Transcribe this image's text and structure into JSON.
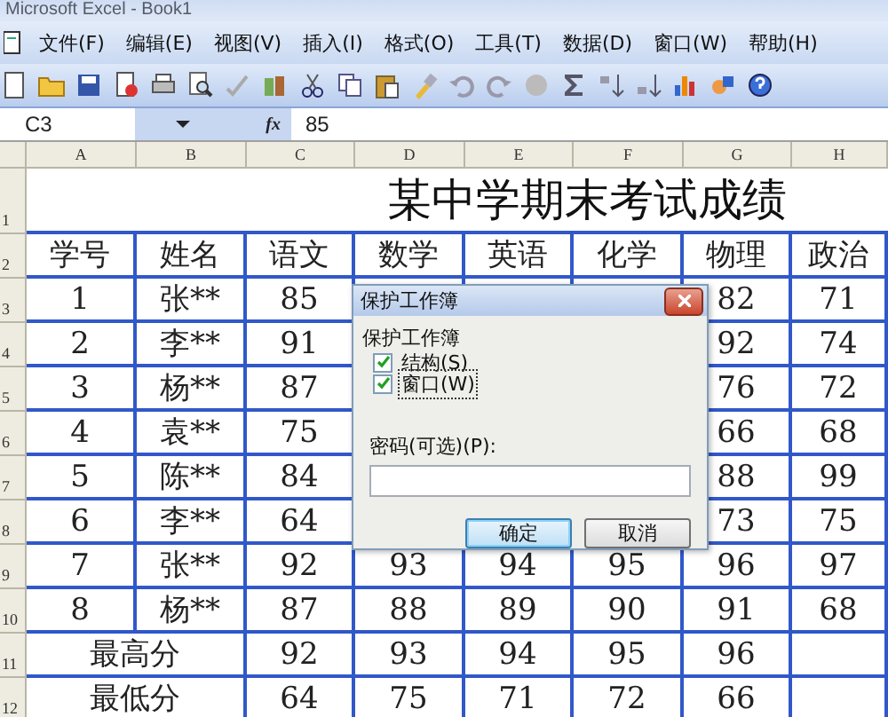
{
  "window": {
    "title": "Microsoft Excel - Book1"
  },
  "menu": [
    "文件(F)",
    "编辑(E)",
    "视图(V)",
    "插入(I)",
    "格式(O)",
    "工具(T)",
    "数据(D)",
    "窗口(W)",
    "帮助(H)"
  ],
  "formula_bar": {
    "name_box": "C3",
    "fx": "fx",
    "value": "85"
  },
  "sheet": {
    "columns": [
      "A",
      "B",
      "C",
      "D",
      "E",
      "F",
      "G",
      "H"
    ],
    "rows": [
      {
        "kind": "title",
        "number": "1",
        "text": "某中学期末考试成绩"
      },
      {
        "kind": "cells",
        "number": "2",
        "cells": [
          "学号",
          "姓名",
          "语文",
          "数学",
          "英语",
          "化学",
          "物理",
          "政治"
        ]
      },
      {
        "kind": "cells",
        "number": "3",
        "cells": [
          "1",
          "张**",
          "85"
        ],
        "right_cells": [
          "82",
          "71"
        ]
      },
      {
        "kind": "cells",
        "number": "4",
        "cells": [
          "2",
          "李**",
          "91"
        ],
        "right_cells": [
          "92",
          "74"
        ]
      },
      {
        "kind": "cells",
        "number": "5",
        "cells": [
          "3",
          "杨**",
          "87"
        ],
        "right_cells": [
          "76",
          "72"
        ]
      },
      {
        "kind": "cells",
        "number": "6",
        "cells": [
          "4",
          "袁**",
          "75"
        ],
        "right_cells": [
          "66",
          "68"
        ]
      },
      {
        "kind": "cells",
        "number": "7",
        "cells": [
          "5",
          "陈**",
          "84"
        ],
        "right_cells": [
          "88",
          "99"
        ]
      },
      {
        "kind": "cells",
        "number": "8",
        "cells": [
          "6",
          "李**",
          "64"
        ],
        "right_cells": [
          "73",
          "75"
        ]
      },
      {
        "kind": "cells",
        "number": "9",
        "cells": [
          "7",
          "张**",
          "92",
          "93",
          "94",
          "95",
          "96",
          "97"
        ]
      },
      {
        "kind": "cells",
        "number": "10",
        "cells": [
          "8",
          "杨**",
          "87",
          "88",
          "89",
          "90",
          "91",
          "68"
        ]
      },
      {
        "kind": "summary",
        "number": "11",
        "label": "最高分",
        "cells": [
          "92",
          "93",
          "94",
          "95",
          "96"
        ]
      },
      {
        "kind": "summary",
        "number": "12",
        "label": "最低分",
        "cells": [
          "64",
          "75",
          "71",
          "72",
          "66"
        ]
      }
    ]
  },
  "dialog": {
    "title": "保护工作簿",
    "group_label": "保护工作簿",
    "checkboxes": [
      {
        "label": "结构(S)",
        "checked": true,
        "focused": false
      },
      {
        "label": "窗口(W)",
        "checked": true,
        "focused": true
      }
    ],
    "password_label": "密码(可选)(P):",
    "buttons": [
      {
        "label": "确定",
        "default": true
      },
      {
        "label": "取消",
        "default": false
      }
    ]
  }
}
